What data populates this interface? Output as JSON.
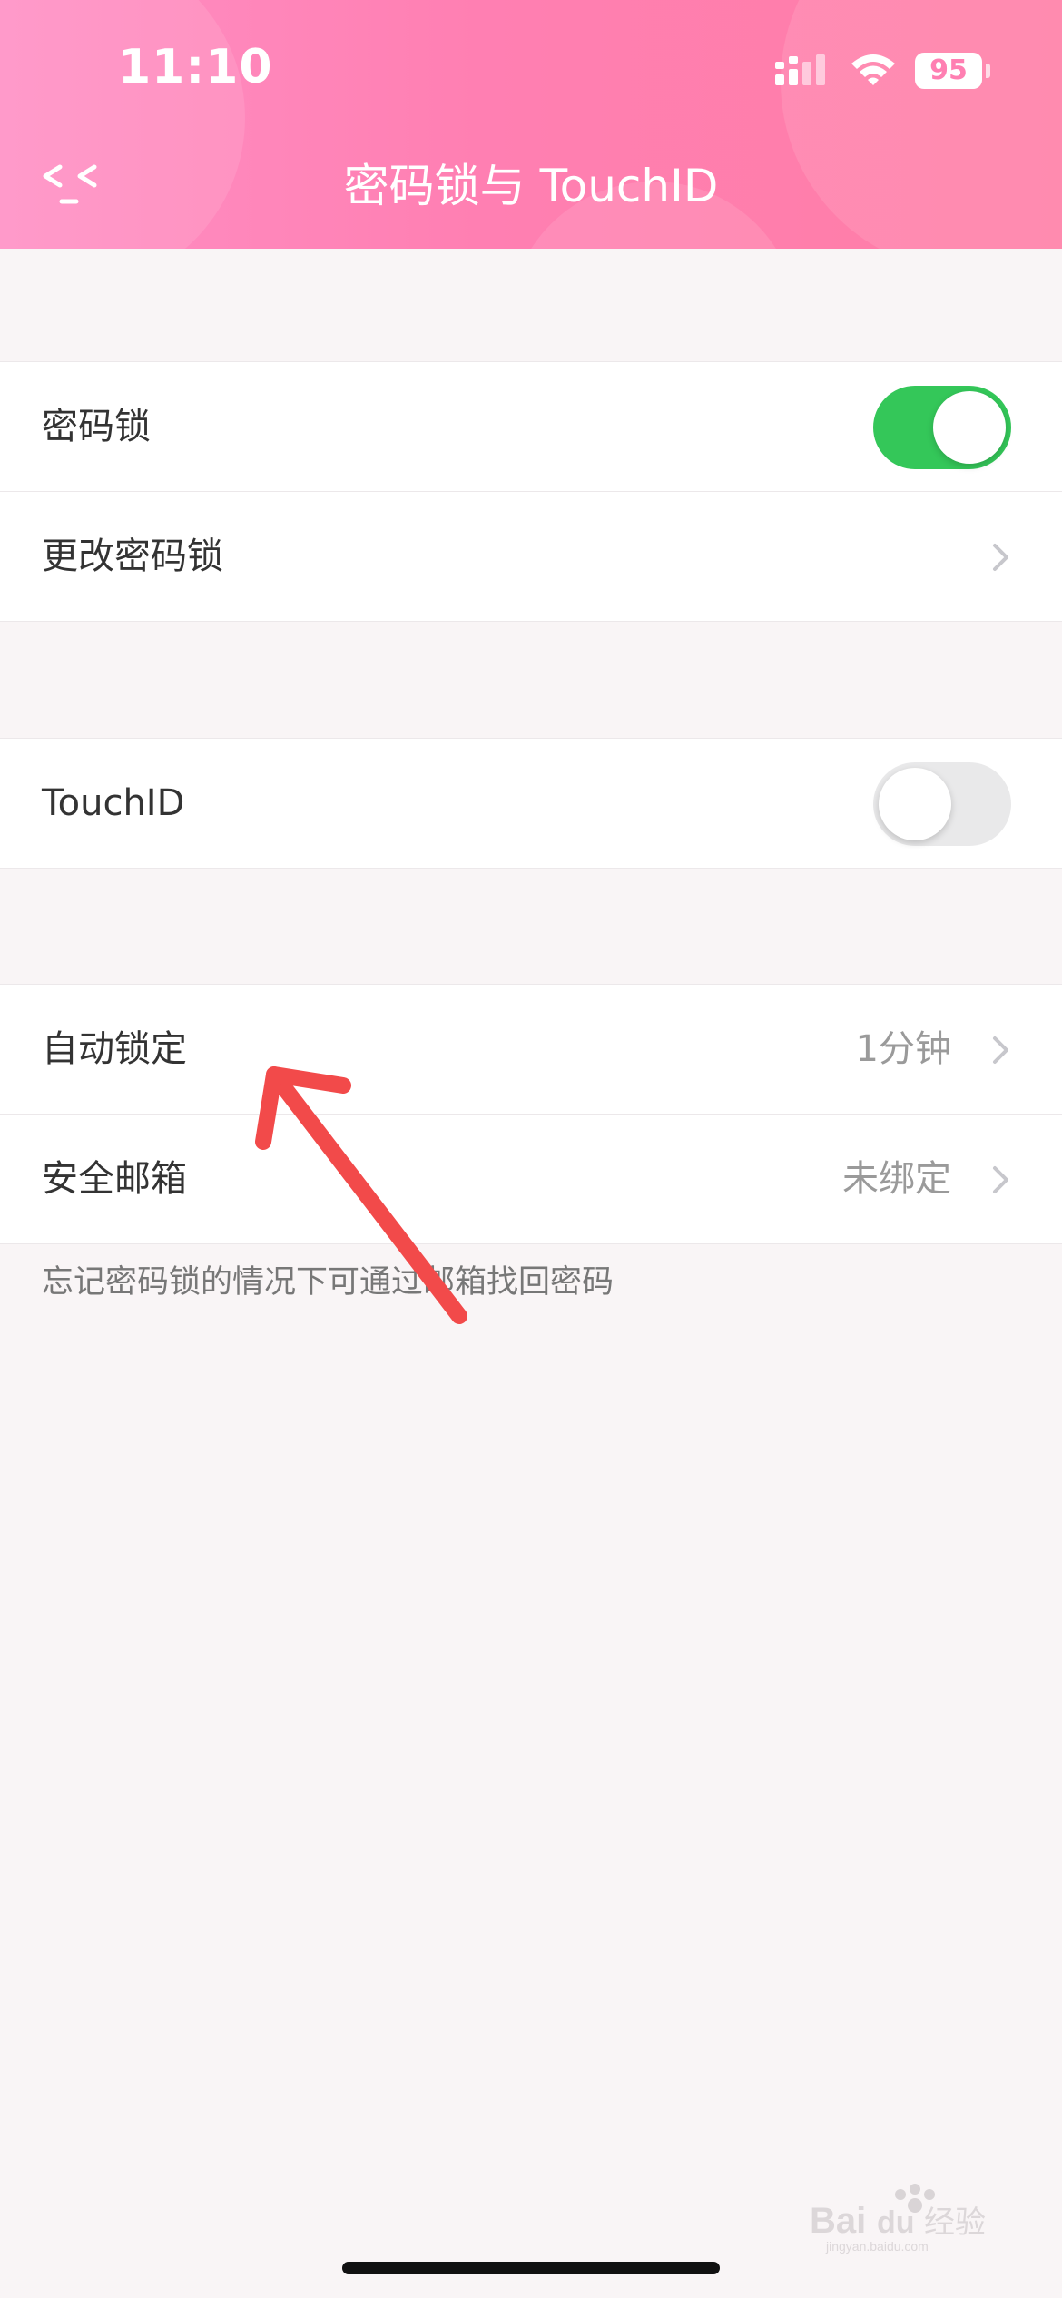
{
  "status_bar": {
    "time": "11:10",
    "battery": "95"
  },
  "nav": {
    "back_label": "<_<",
    "title": "密码锁与 TouchID"
  },
  "groups": {
    "passcode": {
      "lock_label": "密码锁",
      "lock_enabled": true,
      "change_label": "更改密码锁"
    },
    "touchid": {
      "label": "TouchID",
      "enabled": false
    },
    "security": {
      "autolock_label": "自动锁定",
      "autolock_value": "1分钟",
      "email_label": "安全邮箱",
      "email_value": "未绑定"
    }
  },
  "footnote": "忘记密码锁的情况下可通过邮箱找回密码",
  "watermark": {
    "text": "Bai",
    "text2": "du",
    "text3": "经验",
    "subtext": "jingyan.baidu.com"
  },
  "colors": {
    "header_pink": "#ff7fb2",
    "toggle_on": "#34c759",
    "arrow_red": "#f24a4a"
  },
  "icons": {
    "back": "chevron-left-icon",
    "chevron": "chevron-right-icon"
  }
}
